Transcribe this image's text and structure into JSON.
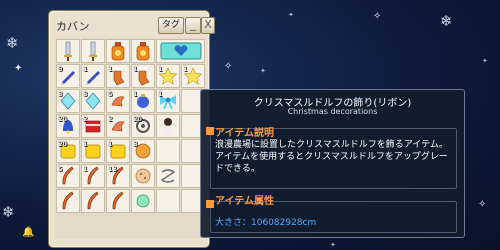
{
  "inventory": {
    "title": "カバン",
    "tag_button": "タグ",
    "minimize_glyph": "_",
    "close_glyph": "X",
    "slots": [
      {
        "icon": "sword-icon",
        "count": ""
      },
      {
        "icon": "sword-icon",
        "count": ""
      },
      {
        "icon": "potion-icon",
        "count": ""
      },
      {
        "icon": "potion-icon",
        "count": ""
      },
      {
        "icon": "heart-box-icon",
        "count": "",
        "wide": true
      },
      {
        "icon": "pen-icon",
        "count": "9"
      },
      {
        "icon": "pen-icon",
        "count": "1"
      },
      {
        "icon": "stocking-icon",
        "count": "1"
      },
      {
        "icon": "stocking-icon",
        "count": "1"
      },
      {
        "icon": "star-icon",
        "count": "1"
      },
      {
        "icon": "star-icon",
        "count": "1"
      },
      {
        "icon": "crystal-icon",
        "count": "3"
      },
      {
        "icon": "crystal-icon",
        "count": "3"
      },
      {
        "icon": "shrimp-icon",
        "count": "5"
      },
      {
        "icon": "ornament-icon",
        "count": "1"
      },
      {
        "icon": "ribbon-icon",
        "count": "1"
      },
      {
        "icon": "empty",
        "count": ""
      },
      {
        "icon": "bell-icon",
        "count": "20"
      },
      {
        "icon": "red-book-icon",
        "count": "2"
      },
      {
        "icon": "shrimp-icon",
        "count": "2"
      },
      {
        "icon": "knot-icon",
        "count": "20"
      },
      {
        "icon": "angel-icon",
        "count": ""
      },
      {
        "icon": "empty",
        "count": ""
      },
      {
        "icon": "yellow-box-icon",
        "count": "20"
      },
      {
        "icon": "yellow-box-icon",
        "count": "1"
      },
      {
        "icon": "yellow-box-icon",
        "count": "1"
      },
      {
        "icon": "orange-box-icon",
        "count": "3"
      },
      {
        "icon": "empty",
        "count": ""
      },
      {
        "icon": "empty",
        "count": ""
      },
      {
        "icon": "feather-icon",
        "count": "5"
      },
      {
        "icon": "feather-icon",
        "count": "1"
      },
      {
        "icon": "feather-icon",
        "count": "13"
      },
      {
        "icon": "cookie-icon",
        "count": ""
      },
      {
        "icon": "spring-icon",
        "count": ""
      },
      {
        "icon": "empty",
        "count": ""
      },
      {
        "icon": "feather-icon",
        "count": ""
      },
      {
        "icon": "feather-icon",
        "count": ""
      },
      {
        "icon": "feather-icon",
        "count": ""
      },
      {
        "icon": "gem-icon",
        "count": ""
      },
      {
        "icon": "empty",
        "count": ""
      },
      {
        "icon": "empty",
        "count": ""
      }
    ]
  },
  "tooltip": {
    "item_name": "クリスマスルドルフの飾り(リボン)",
    "item_name_en": "Christmas decorations",
    "description_header": "アイテム説明",
    "description": "浪漫農場に設置したクリスマスルドルフを飾るアイテム。アイテムを使用するとクリスマスルドルフをアップグレードできる。",
    "attribute_header": "アイテム属性",
    "size_label": "大きさ：106082928cm"
  },
  "colors": {
    "section_header": "#ff9a3a",
    "size_text": "#5aa8ff",
    "tooltip_bg": "#121c2e"
  }
}
